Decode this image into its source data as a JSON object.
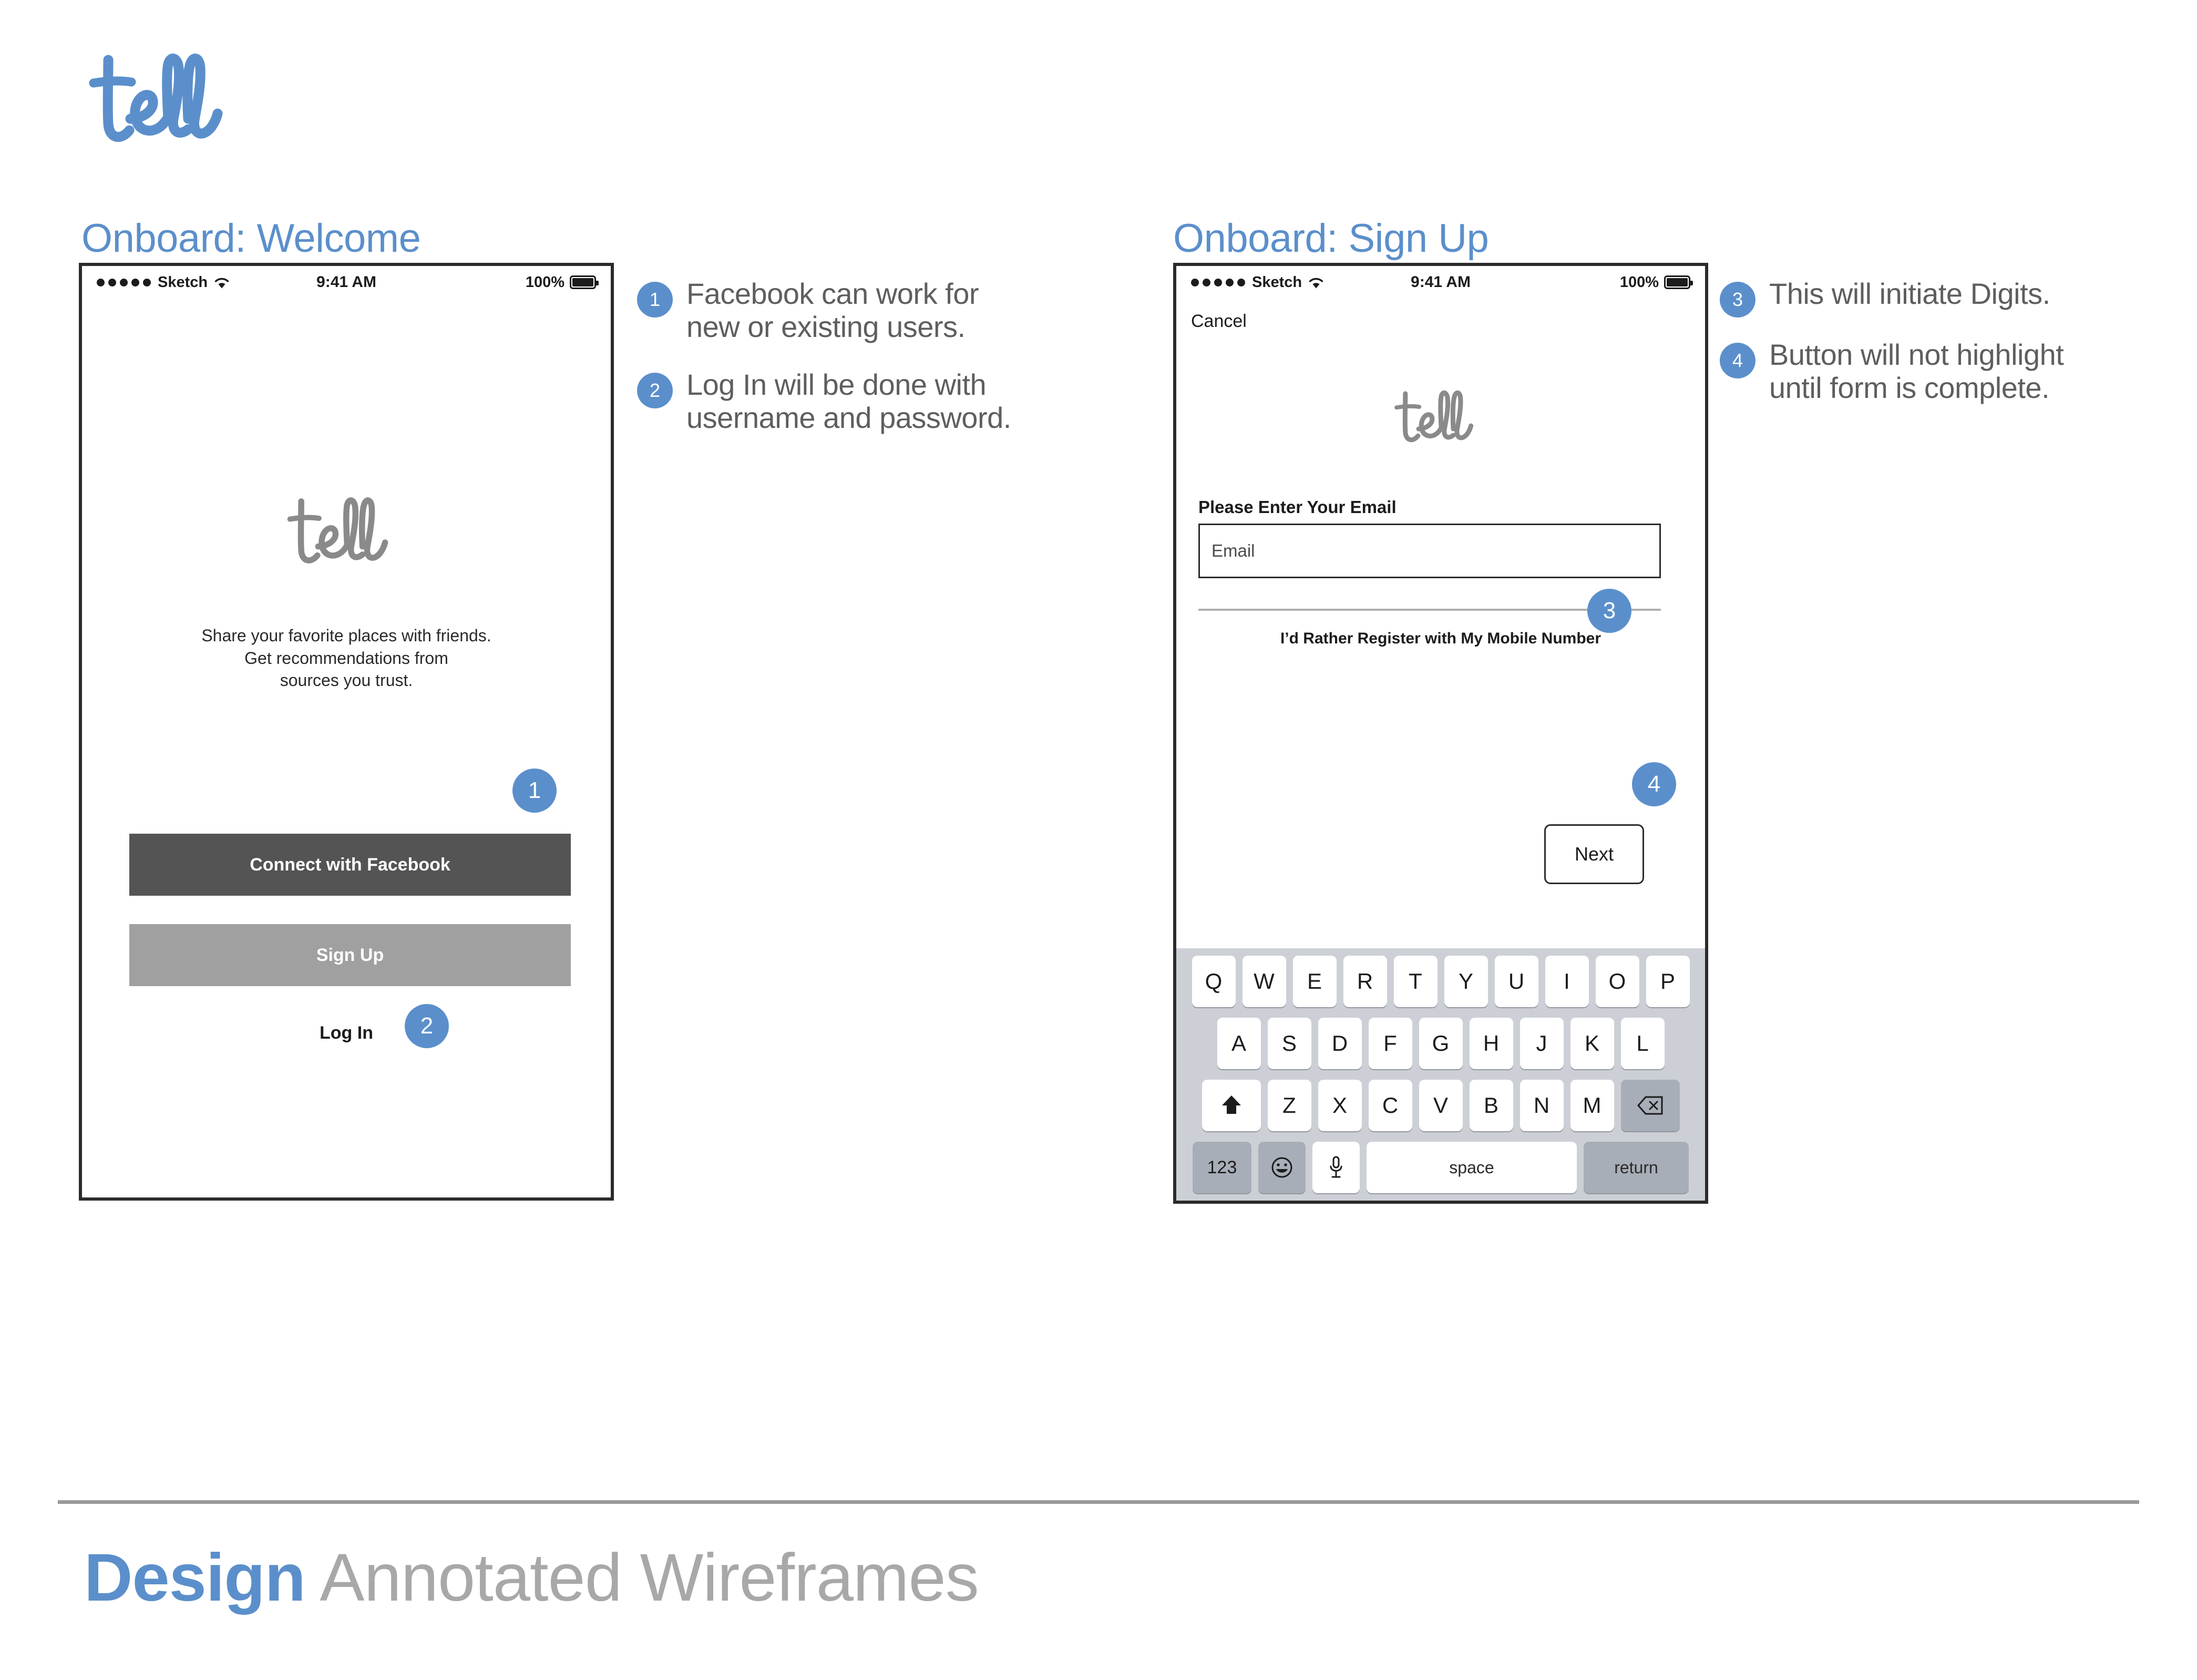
{
  "brand": {
    "logo_text": "tell",
    "logo_color": "#5B8FCB",
    "inline_logo_color": "#8A8A8A"
  },
  "accent_colors": {
    "blue": "#5B8FCB",
    "heading_gray": "#5E5E5E",
    "footer_gray": "#A8A8A8",
    "dark_button": "#545454",
    "light_button": "#A0A0A0",
    "keyboard_bg": "#CCD0D6",
    "keyboard_key_dark": "#A8AEB8"
  },
  "screens": [
    {
      "title": "Onboard: Welcome",
      "status_bar": {
        "carrier": "Sketch",
        "time": "9:41 AM",
        "battery": "100%",
        "signal_dots": 5
      },
      "logo_text": "tell",
      "tagline": "Share your favorite places with friends. Get recommendations from sources you trust.",
      "tagline_lines": [
        "Share your favorite places with friends.",
        "Get recommendations from",
        "sources you trust."
      ],
      "buttons": {
        "facebook": "Connect with Facebook",
        "signup": "Sign Up",
        "login": "Log In"
      }
    },
    {
      "title": "Onboard: Sign Up",
      "status_bar": {
        "carrier": "Sketch",
        "time": "9:41 AM",
        "battery": "100%",
        "signal_dots": 5
      },
      "cancel": "Cancel",
      "logo_text": "tell",
      "field_label": "Please Enter Your Email",
      "email_placeholder": "Email",
      "email_value": "",
      "alt_register": "I’d Rather Register with My Mobile Number",
      "next_button": "Next",
      "keyboard": {
        "row1": [
          "Q",
          "W",
          "E",
          "R",
          "T",
          "Y",
          "U",
          "I",
          "O",
          "P"
        ],
        "row2": [
          "A",
          "S",
          "D",
          "F",
          "G",
          "H",
          "J",
          "K",
          "L"
        ],
        "row3": [
          "Z",
          "X",
          "C",
          "V",
          "B",
          "N",
          "M"
        ],
        "shift_key": "shift-icon",
        "backspace_key": "backspace-icon",
        "numbers_key": "123",
        "emoji_key": "emoji-icon",
        "mic_key": "microphone-icon",
        "space_key": "space",
        "return_key": "return"
      }
    }
  ],
  "annotations_left": [
    {
      "number": "1",
      "text": "Facebook can work for new or existing users."
    },
    {
      "number": "2",
      "text": "Log In will be done with username and password."
    }
  ],
  "annotations_right": [
    {
      "number": "3",
      "text": "This will initiate Digits."
    },
    {
      "number": "4",
      "text": "Button will not highlight until form is complete."
    }
  ],
  "callout_badges": {
    "facebook": "1",
    "login": "2",
    "email_field": "3",
    "next_button": "4"
  },
  "footer": {
    "bold_word": "Design",
    "light_words": " Annotated Wireframes"
  }
}
